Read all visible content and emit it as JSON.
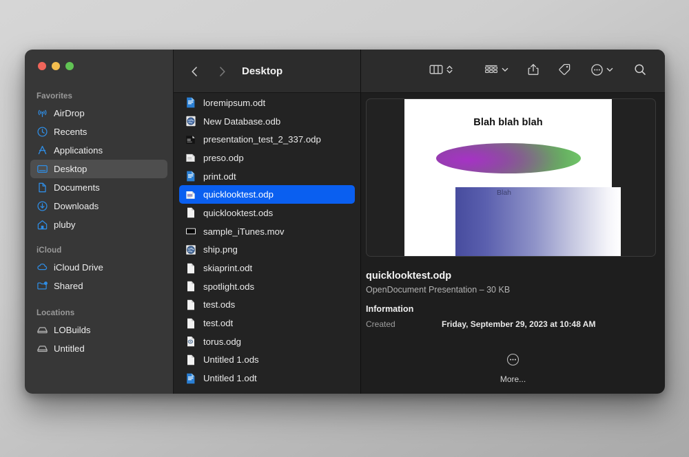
{
  "window": {
    "title": "Desktop",
    "traffic_lights": [
      {
        "name": "close",
        "color": "#f0655a"
      },
      {
        "name": "minimize",
        "color": "#f3bd4e"
      },
      {
        "name": "maximize",
        "color": "#61c354"
      }
    ]
  },
  "toolbar": {
    "back_icon": "chevron-left-icon",
    "forward_icon": "chevron-right-icon",
    "title": "Desktop",
    "view_columns_icon": "column-view-icon",
    "view_stepper_icon": "chevron-updown-icon",
    "group_icon": "group-by-icon",
    "group_chevron_icon": "chevron-down-icon",
    "share_icon": "share-icon",
    "tag_icon": "tag-icon",
    "more_icon": "ellipsis-circle-icon",
    "more_chevron_icon": "chevron-down-icon",
    "search_icon": "search-icon"
  },
  "sidebar": {
    "sections": [
      {
        "title": "Favorites",
        "items": [
          {
            "label": "AirDrop",
            "icon": "airdrop-icon",
            "selected": false
          },
          {
            "label": "Recents",
            "icon": "clock-icon",
            "selected": false
          },
          {
            "label": "Applications",
            "icon": "applications-icon",
            "selected": false
          },
          {
            "label": "Desktop",
            "icon": "desktop-icon",
            "selected": true
          },
          {
            "label": "Documents",
            "icon": "document-icon",
            "selected": false
          },
          {
            "label": "Downloads",
            "icon": "downloads-icon",
            "selected": false
          },
          {
            "label": "pluby",
            "icon": "home-icon",
            "selected": false
          }
        ]
      },
      {
        "title": "iCloud",
        "items": [
          {
            "label": "iCloud Drive",
            "icon": "cloud-icon",
            "selected": false
          },
          {
            "label": "Shared",
            "icon": "shared-folder-icon",
            "selected": false
          }
        ]
      },
      {
        "title": "Locations",
        "items": [
          {
            "label": "LOBuilds",
            "icon": "drive-icon",
            "selected": false
          },
          {
            "label": "Untitled",
            "icon": "drive-icon",
            "selected": false
          }
        ]
      }
    ]
  },
  "file_list": {
    "items": [
      {
        "name": "loremipsum.odt",
        "icon": "odt-writer-icon",
        "selected": false
      },
      {
        "name": "New Database.odb",
        "icon": "odb-database-icon",
        "selected": false
      },
      {
        "name": "presentation_test_2_337.odp",
        "icon": "odp-dark-icon",
        "selected": false
      },
      {
        "name": "preso.odp",
        "icon": "odp-plain-icon",
        "selected": false
      },
      {
        "name": "print.odt",
        "icon": "odt-writer-icon",
        "selected": false
      },
      {
        "name": "quicklooktest.odp",
        "icon": "odp-impress-icon",
        "selected": true
      },
      {
        "name": "quicklooktest.ods",
        "icon": "blank-document-icon",
        "selected": false
      },
      {
        "name": "sample_iTunes.mov",
        "icon": "movie-icon",
        "selected": false
      },
      {
        "name": "ship.png",
        "icon": "image-globe-icon",
        "selected": false
      },
      {
        "name": "skiaprint.odt",
        "icon": "blank-document-icon",
        "selected": false
      },
      {
        "name": "spotlight.ods",
        "icon": "blank-document-icon",
        "selected": false
      },
      {
        "name": "test.ods",
        "icon": "blank-document-icon",
        "selected": false
      },
      {
        "name": "test.odt",
        "icon": "blank-document-icon",
        "selected": false
      },
      {
        "name": "torus.odg",
        "icon": "odg-draw-icon",
        "selected": false
      },
      {
        "name": "Untitled 1.ods",
        "icon": "blank-document-icon",
        "selected": false
      },
      {
        "name": "Untitled 1.odt",
        "icon": "odt-writer-icon",
        "selected": false
      }
    ]
  },
  "preview": {
    "slide": {
      "title": "Blah blah blah",
      "shape_label": "Blah",
      "ellipse_gradient_from": "#8e3fa8",
      "ellipse_gradient_to": "#63c45c",
      "rect_gradient_from": "#474c9e",
      "rect_gradient_to": "#ffffff"
    },
    "filename": "quicklooktest.odp",
    "subtitle": "OpenDocument Presentation – 30 KB",
    "information_heading": "Information",
    "rows": [
      {
        "key": "Created",
        "value": "Friday, September 29, 2023 at 10:48 AM"
      }
    ],
    "more_icon": "ellipsis-circle-icon",
    "more_label": "More..."
  }
}
